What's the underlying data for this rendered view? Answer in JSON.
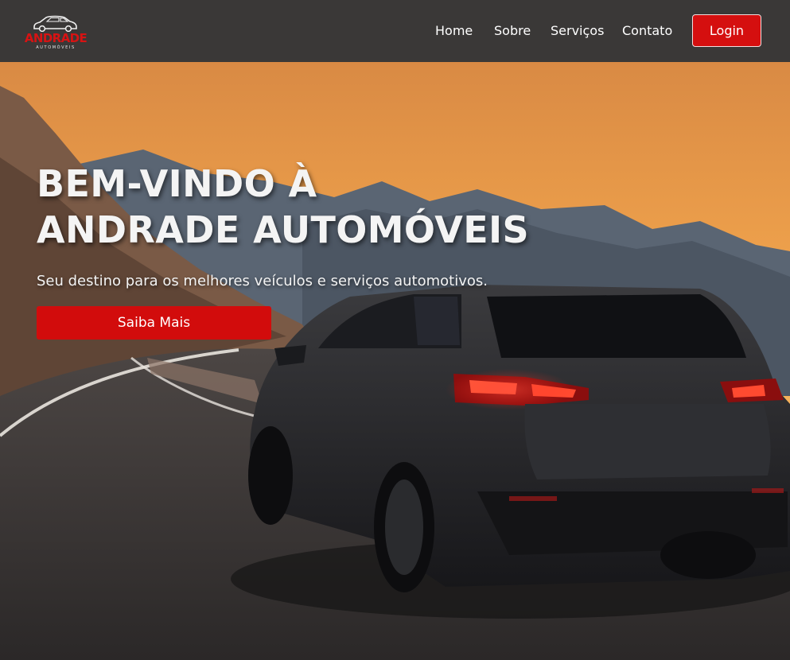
{
  "brand": {
    "name": "ANDRADE",
    "tagline": "AUTOMÓVEIS",
    "icon": "car-logo-icon",
    "color": "#d71313"
  },
  "nav": {
    "items": [
      {
        "label": "Home"
      },
      {
        "label": "Sobre"
      },
      {
        "label": "Serviços"
      },
      {
        "label": "Contato"
      }
    ],
    "login_label": "Login"
  },
  "hero": {
    "title_line1": "BEM-VINDO À",
    "title_line2": "ANDRADE AUTOMÓVEIS",
    "subtitle": "Seu destino para os melhores veículos e serviços automotivos.",
    "cta_label": "Saiba Mais"
  },
  "colors": {
    "header_bg": "#3a3837",
    "accent": "#d50f0f",
    "text": "#ffffff"
  }
}
